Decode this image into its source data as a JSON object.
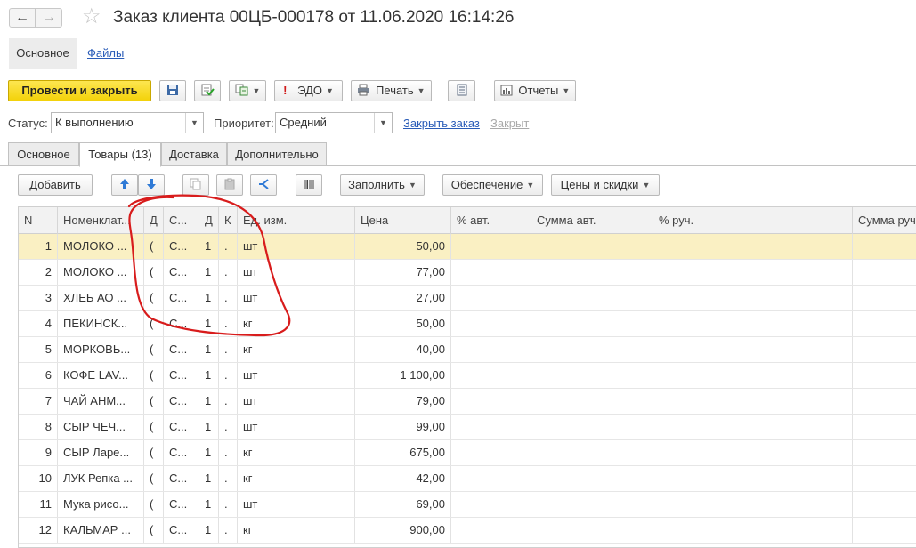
{
  "window": {
    "title": "Заказ клиента 00ЦБ-000178 от 11.06.2020 16:14:26",
    "back_glyph": "←",
    "forward_glyph": "→",
    "favorite_glyph": "☆"
  },
  "navpanel": {
    "main": "Основное",
    "files": "Файлы"
  },
  "commandbar": {
    "post_close": "Провести и закрыть",
    "edo": "ЭДО",
    "print": "Печать",
    "reports": "Отчеты",
    "icons": [
      "save-icon",
      "post-icon",
      "create-based-on-icon",
      "edo-alert-icon",
      "printer-icon",
      "ledger-icon",
      "reports-icon"
    ]
  },
  "status": {
    "label": "Статус:",
    "value": "К выполнению",
    "priority_label": "Приоритет:",
    "priority_value": "Средний",
    "close_order": "Закрыть заказ",
    "closed": "Закрыт"
  },
  "tabs": [
    "Основное",
    "Товары (13)",
    "Доставка",
    "Дополнительно"
  ],
  "table_toolbar": {
    "add": "Добавить",
    "fill": "Заполнить",
    "provision": "Обеспечение",
    "prices": "Цены и скидки",
    "icons": [
      "move-up-icon",
      "move-down-icon",
      "copy-icon",
      "paste-icon",
      "split-icon",
      "barcode-icon"
    ]
  },
  "table": {
    "columns": [
      "N",
      "Номенклат...",
      "Д",
      "С...",
      "Д",
      "К",
      "Ед. изм.",
      "Цена",
      "% авт.",
      "Сумма авт.",
      "% руч.",
      "Сумма руч"
    ],
    "rows": [
      [
        "1",
        "МОЛОКО ...",
        "(",
        "С...",
        "1",
        ".",
        "шт",
        "50,00"
      ],
      [
        "2",
        "МОЛОКО ...",
        "(",
        "С...",
        "1",
        ".",
        "шт",
        "77,00"
      ],
      [
        "3",
        "ХЛЕБ АО ...",
        "(",
        "С...",
        "1",
        ".",
        "шт",
        "27,00"
      ],
      [
        "4",
        "ПЕКИНСК...",
        "(",
        "С...",
        "1",
        ".",
        "кг",
        "50,00"
      ],
      [
        "5",
        "МОРКОВЬ...",
        "(",
        "С...",
        "1",
        ".",
        "кг",
        "40,00"
      ],
      [
        "6",
        "КОФЕ LAV...",
        "(",
        "С...",
        "1",
        ".",
        "шт",
        "1 100,00"
      ],
      [
        "7",
        "ЧАЙ АНМ...",
        "(",
        "С...",
        "1",
        ".",
        "шт",
        "79,00"
      ],
      [
        "8",
        "СЫР ЧЕЧ...",
        "(",
        "С...",
        "1",
        ".",
        "шт",
        "99,00"
      ],
      [
        "9",
        "СЫР Ларе...",
        "(",
        "С...",
        "1",
        ".",
        "кг",
        "675,00"
      ],
      [
        "10",
        "ЛУК Репка ...",
        "(",
        "С...",
        "1",
        ".",
        "кг",
        "42,00"
      ],
      [
        "11",
        "Мука рисо...",
        "(",
        "С...",
        "1",
        ".",
        "шт",
        "69,00"
      ],
      [
        "12",
        "КАЛЬМАР ...",
        "(",
        "С...",
        "1",
        ".",
        "кг",
        "900,00"
      ]
    ]
  },
  "colors": {
    "primary_button": "#f3d20a",
    "selected_row": "#faf0c3",
    "link": "#2a5cb8",
    "annotation": "#d81c1c"
  }
}
